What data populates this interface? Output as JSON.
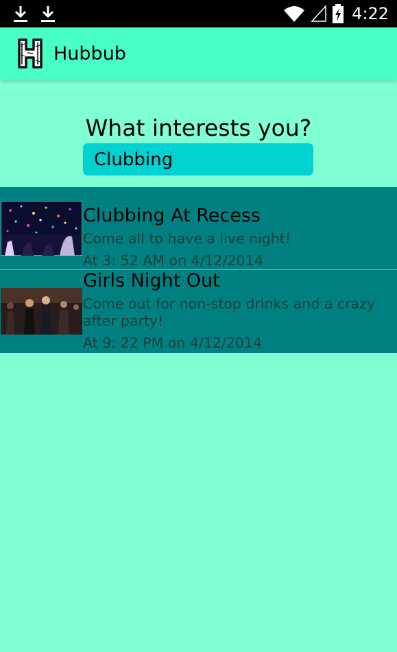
{
  "status_bar": {
    "time": "4:22",
    "icons": [
      "download-icon",
      "download-icon",
      "wifi-icon",
      "signal-icon",
      "battery-icon"
    ]
  },
  "app_bar": {
    "title": "Hubbub",
    "logo_letter": "H"
  },
  "search": {
    "prompt": "What interests you?",
    "value": "Clubbing"
  },
  "events": [
    {
      "title": "Clubbing At Recess",
      "description": "Come all to have a live night!",
      "time": "At 3: 52 AM on 4/12/2014"
    },
    {
      "title": "Girls Night Out",
      "description": "Come out for non-stop drinks and a crazy after party!",
      "time": "At 9: 22 PM on 4/12/2014"
    }
  ],
  "colors": {
    "background": "#80ffd4",
    "app_bar": "#48ffc5",
    "input": "#00d2d2",
    "list_item": "#008080",
    "muted_text": "#1e3f3f"
  }
}
